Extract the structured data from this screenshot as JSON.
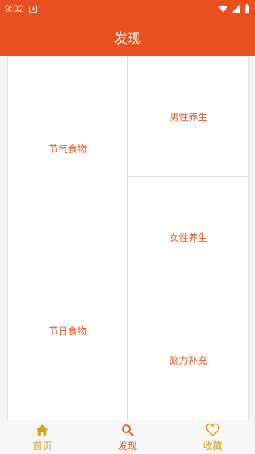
{
  "status": {
    "time": "9:02",
    "notification_glyph": "A"
  },
  "header": {
    "title": "发现"
  },
  "left": [
    {
      "label": "节气食物"
    },
    {
      "label": "节日食物"
    }
  ],
  "right": [
    {
      "label": "男性养生"
    },
    {
      "label": "女性养生"
    },
    {
      "label": "脑力补充"
    }
  ],
  "tabs": [
    {
      "label": "首页",
      "icon": "home-icon"
    },
    {
      "label": "发现",
      "icon": "search-icon"
    },
    {
      "label": "收藏",
      "icon": "heart-icon"
    }
  ],
  "colors": {
    "brand": "#e8511f",
    "accent_text": "#e0602a",
    "tab_inactive": "#d9a11a"
  }
}
